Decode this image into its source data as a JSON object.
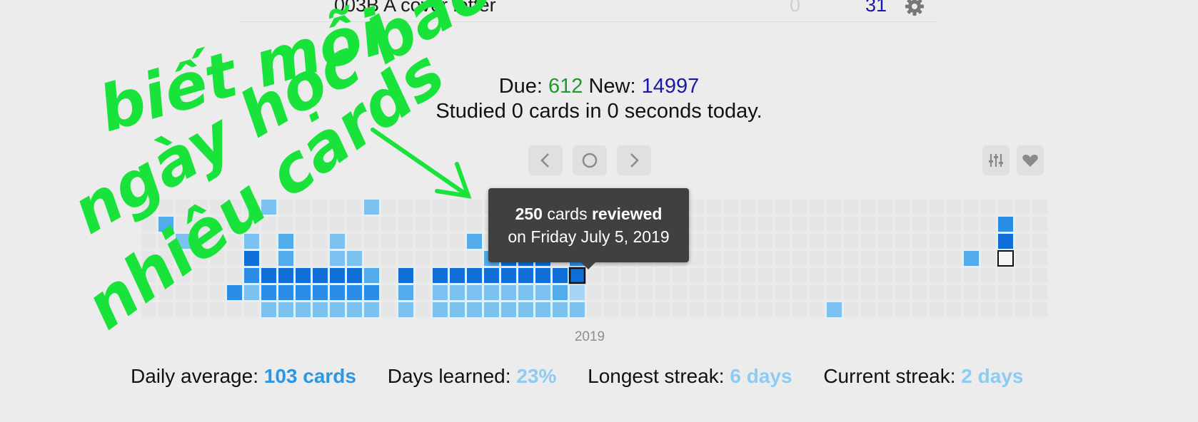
{
  "deck_row": {
    "name": "003B A cover letter",
    "new_count": "0",
    "due_count": "31",
    "gear_icon": "gear-icon"
  },
  "counts": {
    "due_label": "Due:",
    "due_value": "612",
    "new_label": "New:",
    "new_value": "14997",
    "studied_text": "Studied 0 cards in 0 seconds today."
  },
  "nav": {
    "prev_icon": "chevron-left-icon",
    "today_icon": "circle-icon",
    "next_icon": "chevron-right-icon",
    "options_icon": "sliders-icon",
    "heart_icon": "heart-icon"
  },
  "heatmap": {
    "year": "2019",
    "colors": {
      "empty": "#e6e6e6",
      "level1": "#a6d6f5",
      "level2": "#7cc2f0",
      "level3": "#52abeb",
      "level4": "#2a8ee6",
      "level5": "#0f6fd6",
      "today_outline": "#111111"
    }
  },
  "tooltip": {
    "count": "250",
    "cards_word": "cards",
    "reviewed_word": "reviewed",
    "date_line": "on Friday July 5, 2019"
  },
  "stats": {
    "daily_avg_label": "Daily average:",
    "daily_avg_value": "103 cards",
    "days_learned_label": "Days learned:",
    "days_learned_value": "23%",
    "longest_label": "Longest streak:",
    "longest_value": "6 days",
    "current_label": "Current streak:",
    "current_value": "2 days"
  },
  "annotation": {
    "line1": "biết mỗi",
    "line2": "ngày học bao",
    "line3": "nhiêu cards",
    "color": "#19e23a"
  }
}
